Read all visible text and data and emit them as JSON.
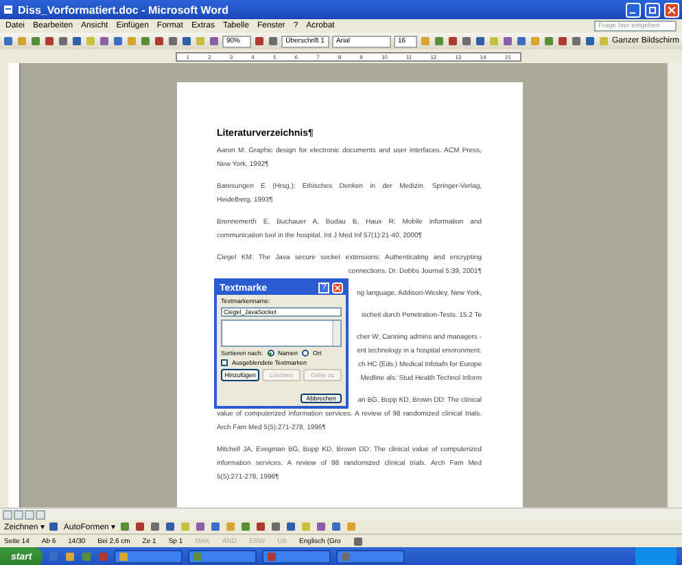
{
  "window": {
    "title": "Diss_Vorformatiert.doc - Microsoft Word"
  },
  "menu": {
    "items": [
      "Datei",
      "Bearbeiten",
      "Ansicht",
      "Einfügen",
      "Format",
      "Extras",
      "Tabelle",
      "Fenster",
      "?",
      "Acrobat"
    ],
    "help_box": {
      "placeholder": "Frage hier eingeben"
    }
  },
  "toolbar": {
    "zoom": "90%",
    "style": "Überschrift 1",
    "font": "Arial",
    "size": "16",
    "reading_button": "Ganzer Bildschirm"
  },
  "ruler": {
    "marks": [
      "1",
      "2",
      "3",
      "4",
      "5",
      "6",
      "7",
      "8",
      "9",
      "10",
      "11",
      "12",
      "13",
      "14",
      "15"
    ]
  },
  "document": {
    "heading": "Literaturverzeichnis¶",
    "paragraphs": [
      {
        "lines": [
          {
            "kind": "full",
            "text": "Aaron M: Graphic design for electronic documents and user interfaces. ACM Press,"
          },
          {
            "kind": "last",
            "text": "New York, 1992¶"
          }
        ]
      },
      {
        "lines": [
          {
            "kind": "full",
            "text": "Baresungen E (Hrsg.): Ethisches Denken in der Medizin. Springer-Verlag,"
          },
          {
            "kind": "last",
            "text": "Heidelberg, 1993¶"
          }
        ]
      },
      {
        "lines": [
          {
            "kind": "full",
            "text": "Brennemerth E, Buchauer A, Budau B, Haux R: Mobile information and"
          },
          {
            "kind": "last",
            "text": "communication tool in the hospital. Int J Med Inf 57(1):21-40, 2000¶"
          }
        ]
      },
      {
        "lines": [
          {
            "kind": "full",
            "text": "Ciegel KM: The Java secure socket extensions: Authenticating and encrypting"
          },
          {
            "kind": "cut",
            "text": "connections. Dr. Dobbs Journal 5:39, 2001¶"
          }
        ]
      },
      {
        "lines": [
          {
            "kind": "cut",
            "text": "ng language. Addison-Wesley, New York,"
          }
        ]
      },
      {
        "lines": [
          {
            "kind": "cut",
            "text": "ischeit durch Penetration-Tests. 15.2 Te"
          }
        ]
      },
      {
        "lines": [
          {
            "kind": "cut",
            "text": "cher W: Canning admins and managers -"
          },
          {
            "kind": "cut",
            "text": "ent technology in a hospital environment."
          },
          {
            "kind": "cut",
            "text": "ch HC (Eds.) Medical Infotafn for Europe"
          },
          {
            "kind": "cut",
            "text": "Medline als: Stud Health Technol Inform"
          }
        ]
      },
      {
        "lines": [
          {
            "kind": "cut",
            "text": "an BG, Bopp KD, Brown DD: The clinical"
          },
          {
            "kind": "full",
            "text": "value of computerized information services. A review of 98 randomized clinical trials."
          },
          {
            "kind": "last",
            "text": "Arch Fam Med 5(5):271-278, 1996¶"
          }
        ]
      },
      {
        "lines": [
          {
            "kind": "full",
            "text": "Mitchell JA, Evegman BG, Bopp KD, Brown DD: The clinical value of computerized"
          },
          {
            "kind": "full",
            "text": "information services. A review of 98 randomized clinical trials. Arch Fam Med"
          },
          {
            "kind": "last",
            "text": "5(5):271-278, 1996¶"
          }
        ]
      }
    ]
  },
  "dialog": {
    "title": "Textmarke",
    "help": "?",
    "name_label": "Textmarkenname:",
    "name_value": "Ciegel_JavaSocket",
    "sort_label": "Sortieren nach:",
    "sort_options": [
      {
        "label": "Namen",
        "selected": true
      },
      {
        "label": "Ort",
        "selected": false
      }
    ],
    "hidden_bookmarks": {
      "label": "Ausgeblendete Textmarken",
      "checked": false
    },
    "buttons": [
      {
        "label": "Hinzufügen",
        "disabled": false
      },
      {
        "label": "Löschen",
        "disabled": true
      },
      {
        "label": "Gehe zu",
        "disabled": true
      }
    ],
    "cancel": "Abbrechen"
  },
  "drawing_toolbar": {
    "draw": "Zeichnen ▾",
    "autoshapes": "AutoFormen ▾"
  },
  "status_bar": {
    "fields": [
      "Seite 14",
      "Ab 6",
      "14/30",
      "Bei 2,6 cm",
      "Ze 1",
      "Sp 1"
    ],
    "modes": [
      {
        "label": "MAK",
        "disabled": true
      },
      {
        "label": "ÄND",
        "disabled": true
      },
      {
        "label": "ERW",
        "disabled": true
      },
      {
        "label": "ÜB",
        "disabled": true
      }
    ],
    "language": "Englisch (Gro"
  },
  "taskbar": {
    "start": "start"
  }
}
